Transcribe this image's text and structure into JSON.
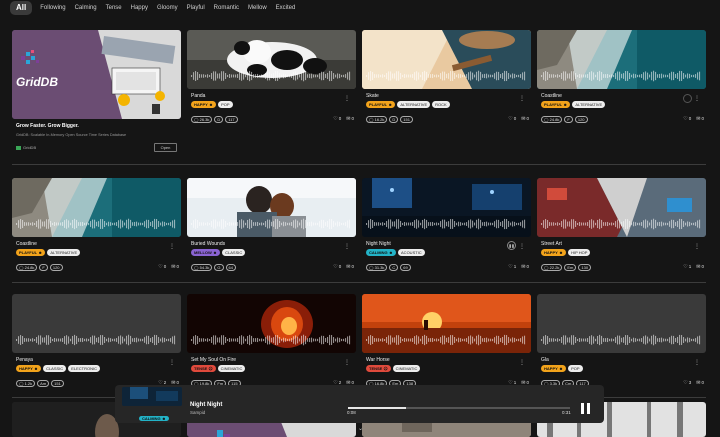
{
  "moods": [
    "All",
    "Following",
    "Calming",
    "Tense",
    "Happy",
    "Gloomy",
    "Playful",
    "Romantic",
    "Mellow",
    "Excited"
  ],
  "colors": {
    "happy": "#f2a31b",
    "playful": "#f2a31b",
    "mellow": "#8a63d2",
    "calming": "#23b3c7",
    "tense": "#e04a3c"
  },
  "ad": {
    "logo": "GridDB",
    "title": "Grow Faster. Grow Bigger.",
    "subtitle": "GridDB: Scalable In-Memory Open Source Time Series Database",
    "brand": "GridDB",
    "button": "Open"
  },
  "cards": [
    {
      "title": "Panda",
      "mood": "HAPPY",
      "mood_icon": "☻",
      "genres": [
        "POP"
      ],
      "plays": "26.3k",
      "key": "D",
      "bpm": "117",
      "likes": "0",
      "comments": "0"
    },
    {
      "title": "Skate",
      "mood": "PLAYFUL",
      "mood_icon": "☻",
      "genres": [
        "ALTERNATIVE",
        "ROCK"
      ],
      "plays": "16.2k",
      "key": "D",
      "bpm": "151",
      "likes": "0",
      "comments": "0"
    },
    {
      "title": "Coastline",
      "mood": "PLAYFUL",
      "mood_icon": "☻",
      "genres": [
        "ALTERNATIVE"
      ],
      "plays": "24.8k",
      "key": "F",
      "bpm": "120",
      "likes": "0",
      "comments": "0"
    },
    {
      "title": "Coastline",
      "mood": "PLAYFUL",
      "mood_icon": "☻",
      "genres": [
        "ALTERNATIVE"
      ],
      "plays": "24.8k",
      "key": "F",
      "bpm": "120",
      "likes": "0",
      "comments": "0"
    },
    {
      "title": "Buried Wounds",
      "mood": "MELLOW",
      "mood_icon": "☻",
      "genres": [
        "CLASSIC"
      ],
      "plays": "54.3k",
      "key": "G",
      "bpm": "64",
      "likes": "0",
      "comments": "0"
    },
    {
      "title": "Night Night",
      "mood": "CALMING",
      "mood_icon": "☻",
      "genres": [
        "ACOUSTIC"
      ],
      "plays": "31.3k",
      "key": "C",
      "bpm": "69",
      "likes": "1",
      "comments": "0"
    },
    {
      "title": "Street Art",
      "mood": "HAPPY",
      "mood_icon": "☻",
      "genres": [
        "HIP HOP"
      ],
      "plays": "22.2k",
      "key": "Em",
      "bpm": "130",
      "likes": "1",
      "comments": "0"
    },
    {
      "title": "Penaya",
      "mood": "HAPPY",
      "mood_icon": "☻",
      "genres": [
        "CLASSIC",
        "ELECTRONIC"
      ],
      "plays": "1.2k",
      "key": "Am",
      "bpm": "151",
      "likes": "2",
      "comments": "0"
    },
    {
      "title": "Set My Soul On Fire",
      "mood": "TENSE",
      "mood_icon": "☹",
      "genres": [
        "CINEMATIC"
      ],
      "plays": "19.8k",
      "key": "Fm",
      "bpm": "115",
      "likes": "2",
      "comments": "0"
    },
    {
      "title": "War Horse",
      "mood": "TENSE",
      "mood_icon": "☹",
      "genres": [
        "CINEMATIC"
      ],
      "plays": "16.8k",
      "key": "Em",
      "bpm": "138",
      "likes": "1",
      "comments": "0"
    },
    {
      "title": "Gla",
      "mood": "HAPPY",
      "mood_icon": "☻",
      "genres": [
        "POP"
      ],
      "plays": "3.3k",
      "key": "Cm",
      "bpm": "117",
      "likes": "3",
      "comments": "0"
    }
  ],
  "player": {
    "title": "Night Night",
    "artist": "Sampid",
    "mood": "CALMING",
    "mood_icon": "☻",
    "current_time": "0:08",
    "duration": "0:31",
    "progress_fraction": 0.26
  },
  "icons": {
    "menu": "⋮",
    "heart": "♡",
    "comment": "✉",
    "play": "▶",
    "pause": "❚❚",
    "chevron": "⌄"
  }
}
